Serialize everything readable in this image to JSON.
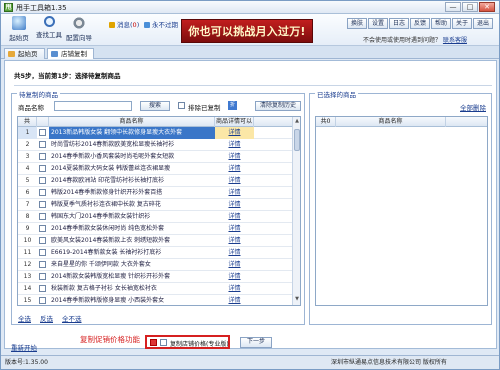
{
  "window": {
    "title": "甩手工具箱1.35",
    "controls": [
      "—",
      "□",
      "✕"
    ]
  },
  "toolbar": {
    "home_label": "起始页",
    "find_tools_label": "查找工具",
    "settings_label": "配置向导",
    "message_count_text": "消息(",
    "message_count": "0",
    "message_count_close": ")",
    "no_expiry_text": "永不过期",
    "banner_text": "你也可以挑战月入过万!",
    "right_buttons": [
      "换肤",
      "设置",
      "日志",
      "反馈",
      "帮助",
      "关于",
      "退出"
    ],
    "sub_text": "不会使用或使用时遇到问题？",
    "sub_link": "联系客服"
  },
  "tabs": [
    {
      "label": "起始页"
    },
    {
      "label": "店铺复制"
    }
  ],
  "step_text": "共5步，当前第1步：选择待复制商品",
  "left_panel": {
    "title": "待复制的商品",
    "search_label": "商品名称",
    "search_value": "",
    "search_button": "搜索",
    "exclude_label": "排除已复制",
    "blue_square_glyph": "折",
    "clear_history_button": "清除复制历史",
    "columns": [
      "共 106",
      "",
      "商品名称",
      "商品详情可以"
    ],
    "rows": [
      {
        "index": "1",
        "checked": false,
        "name": "2013新品韩版女装 翻领中长款修身显瘦大衣外套",
        "detail": "详情",
        "selected": true
      },
      {
        "index": "2",
        "checked": false,
        "name": "时尚雪纺衫2014春新款欧美宽松显瘦长袖衬衫",
        "detail": "详情",
        "selected": false
      },
      {
        "index": "3",
        "checked": false,
        "name": "2014春季新款小香风套装时尚毛呢外套女短款",
        "detail": "详情",
        "selected": false
      },
      {
        "index": "4",
        "checked": false,
        "name": "2014夏装新款大码女装 韩版蕾丝连衣裙显瘦",
        "detail": "详情",
        "selected": false
      },
      {
        "index": "5",
        "checked": false,
        "name": "2014春款欧洲站 印花雪纺衬衫长袖打底衫",
        "detail": "详情",
        "selected": false
      },
      {
        "index": "6",
        "checked": false,
        "name": "韩版2014春季新款修身针织开衫外套百搭",
        "detail": "详情",
        "selected": false
      },
      {
        "index": "7",
        "checked": false,
        "name": "韩版夏季气质衬衫连衣裙中长款 复古碎花",
        "detail": "详情",
        "selected": false
      },
      {
        "index": "8",
        "checked": false,
        "name": "韩国东大门2014春季新款女装针织衫",
        "detail": "详情",
        "selected": false
      },
      {
        "index": "9",
        "checked": false,
        "name": "2014春季新款女装休闲时尚 纯色宽松外套",
        "detail": "详情",
        "selected": false
      },
      {
        "index": "10",
        "checked": false,
        "name": "欧美风女装2014春装新款上衣 刺绣短款外套",
        "detail": "详情",
        "selected": false
      },
      {
        "index": "11",
        "checked": false,
        "name": "E6619-2014春新款女装 长袖衬衫打底衫",
        "detail": "详情",
        "selected": false
      },
      {
        "index": "12",
        "checked": false,
        "name": "来自星星的你 千颂伊同款 大衣外套女",
        "detail": "详情",
        "selected": false
      },
      {
        "index": "13",
        "checked": false,
        "name": "2014新款女装韩版宽松显瘦 针织衫开衫外套",
        "detail": "详情",
        "selected": false
      },
      {
        "index": "14",
        "checked": false,
        "name": "秋装新款 复古格子衬衫 女长袖宽松衬衣",
        "detail": "详情",
        "selected": false
      },
      {
        "index": "15",
        "checked": false,
        "name": "2014春季新款韩版修身显瘦 小西装外套女",
        "detail": "详情",
        "selected": false
      },
      {
        "index": "16",
        "checked": false,
        "name": "2014新款女装 时尚百搭 纯棉T恤打底衫",
        "detail": "详情",
        "selected": false
      },
      {
        "index": "17",
        "checked": false,
        "name": "女2014春装新款 韩版 长袖连衣裙 修身",
        "detail": "详情",
        "selected": false
      }
    ],
    "select_all": "全选",
    "invert": "反选",
    "select_none": "全不选"
  },
  "right_panel": {
    "title": "已选择的商品",
    "delete_all": "全部删除",
    "columns": [
      "共0",
      "商品名称"
    ]
  },
  "bottom": {
    "restart": "重新开始",
    "annotation": "复制促销价格功能",
    "copy_promo_label": "复制店铺价格(专业版)",
    "next_button": "下一步"
  },
  "status": {
    "version": "版本号:1.35.00",
    "company": "深圳市纵通易点信息技术有限公司 版权所有"
  }
}
